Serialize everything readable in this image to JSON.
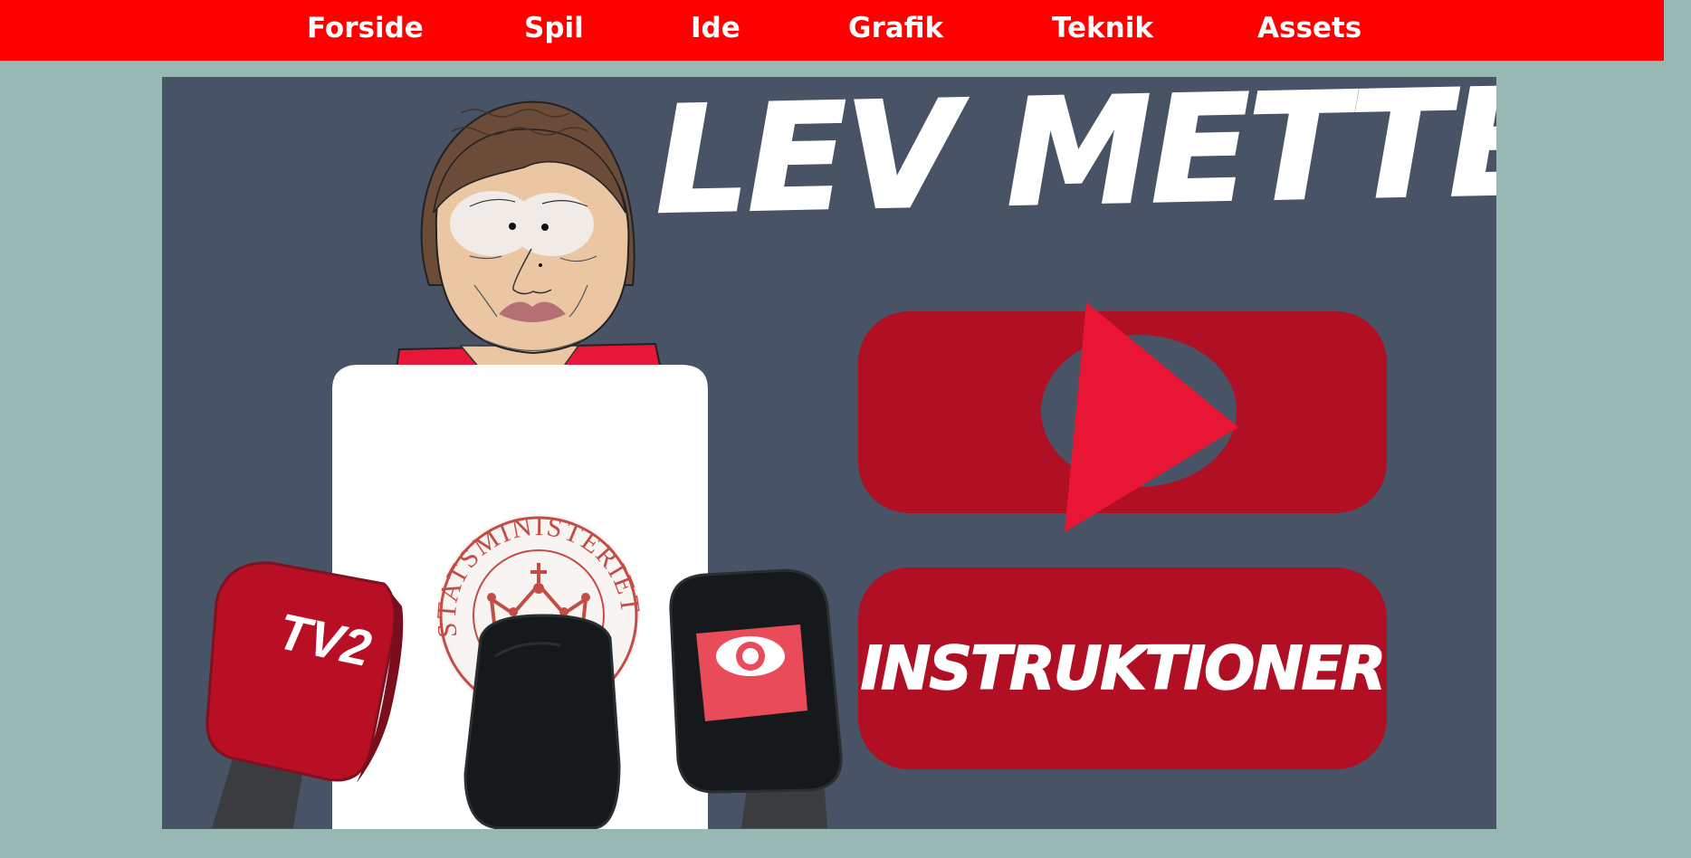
{
  "nav": {
    "items": [
      {
        "label": "Forside"
      },
      {
        "label": "Spil"
      },
      {
        "label": "Ide"
      },
      {
        "label": "Grafik"
      },
      {
        "label": "Teknik"
      },
      {
        "label": "Assets"
      }
    ]
  },
  "game": {
    "title": "LEV METTE!",
    "instructions_label": "INSTRUKTIONER",
    "seal_text": "STATSMINISTERIET",
    "mic_left_logo": "TV2"
  },
  "colors": {
    "nav_bg": "#ff0000",
    "page_bg": "#97b8b3",
    "game_bg": "#485366",
    "button_bg": "#b00f24",
    "play_triangle": "#e81634"
  },
  "icons": {
    "play": "play-triangle-icon"
  }
}
